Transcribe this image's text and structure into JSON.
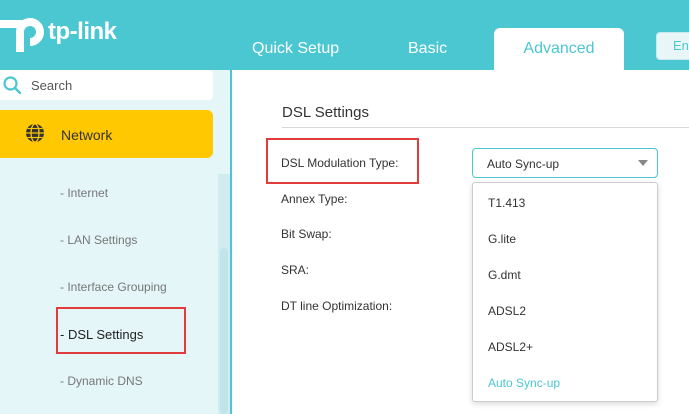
{
  "brand": {
    "logo_text": "tp-link",
    "color_primary": "#4bc7d2",
    "color_active": "#ffc800",
    "color_highlight": "#e23b3b"
  },
  "tabs": {
    "quick_setup": "Quick Setup",
    "basic": "Basic",
    "advanced": "Advanced",
    "language_partial": "En"
  },
  "sidebar": {
    "search_placeholder": "Search",
    "active_item": "Network",
    "sub_items": {
      "internet": "- Internet",
      "lan_settings": "- LAN Settings",
      "interface_grouping": "- Interface Grouping",
      "dsl_settings": "- DSL Settings",
      "dynamic_dns": "- Dynamic DNS"
    }
  },
  "main": {
    "section_title": "DSL Settings",
    "labels": {
      "modulation_type": "DSL Modulation Type:",
      "annex_type": "Annex Type:",
      "bit_swap": "Bit Swap:",
      "sra": "SRA:",
      "dt_line": "DT line Optimization:"
    },
    "modulation_select": {
      "selected": "Auto Sync-up",
      "options": [
        "T1.413",
        "G.lite",
        "G.dmt",
        "ADSL2",
        "ADSL2+",
        "Auto Sync-up"
      ]
    }
  }
}
